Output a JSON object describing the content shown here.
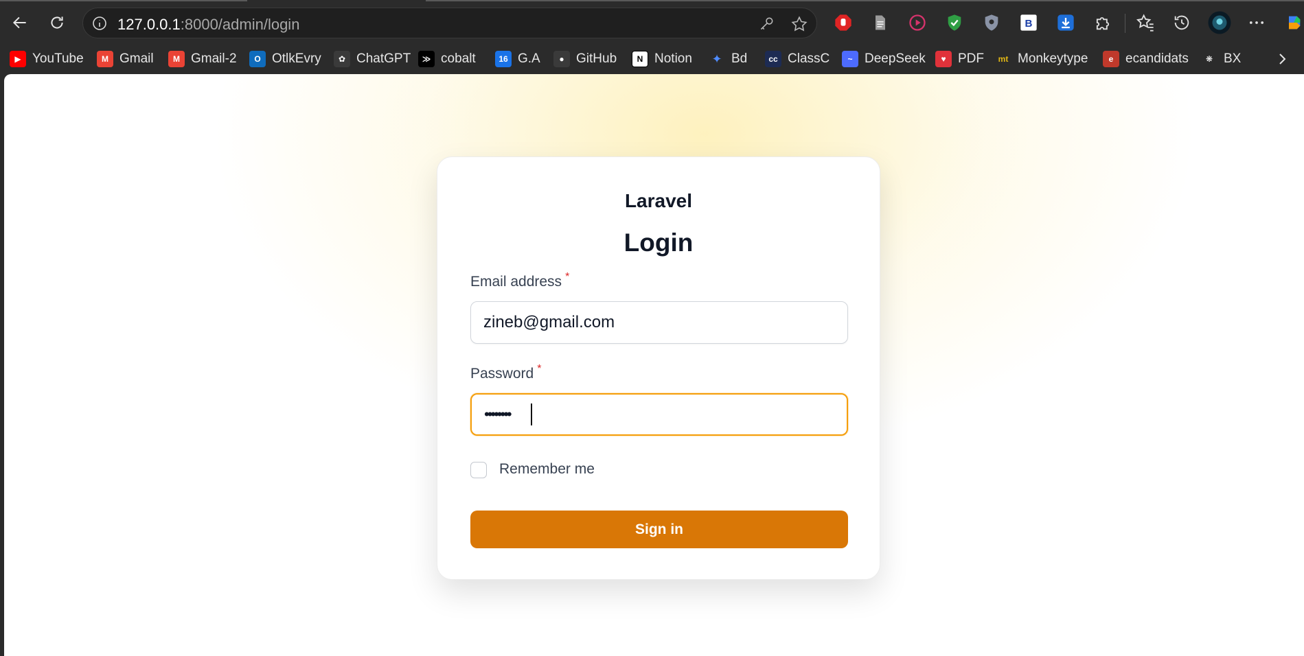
{
  "browser": {
    "address": {
      "host": "127.0.0.1",
      "path": ":8000/admin/login"
    },
    "bookmarks": [
      {
        "label": "YouTube",
        "icon": "youtube-icon",
        "color": "#ff0000",
        "glyph": "▶"
      },
      {
        "label": "Gmail",
        "icon": "gmail-icon",
        "color": "#ea4335",
        "glyph": "M"
      },
      {
        "label": "Gmail-2",
        "icon": "gmail-icon",
        "color": "#ea4335",
        "glyph": "M"
      },
      {
        "label": "OtlkEvry",
        "icon": "outlook-icon",
        "color": "#0f6cbd",
        "glyph": "O"
      },
      {
        "label": "ChatGPT",
        "icon": "chatgpt-icon",
        "color": "#3a3a3a",
        "glyph": "✿"
      },
      {
        "label": "cobalt",
        "icon": "cobalt-icon",
        "color": "#000000",
        "glyph": "≫"
      },
      {
        "label": "G.A",
        "icon": "calendar-icon",
        "color": "#1a73e8",
        "glyph": "16"
      },
      {
        "label": "GitHub",
        "icon": "github-icon",
        "color": "#3a3a3a",
        "glyph": "●"
      },
      {
        "label": "Notion",
        "icon": "notion-icon",
        "color": "#ffffff",
        "glyph": "N"
      },
      {
        "label": "Bd",
        "icon": "gemini-icon",
        "color": "#2b2b2b",
        "glyph": "✦"
      },
      {
        "label": "ClassC",
        "icon": "classc-icon",
        "color": "#1d2b53",
        "glyph": "cc"
      },
      {
        "label": "DeepSeek",
        "icon": "deepseek-icon",
        "color": "#4d6bfe",
        "glyph": "~"
      },
      {
        "label": "PDF",
        "icon": "pdf-heart-icon",
        "color": "#e0323a",
        "glyph": "♥"
      },
      {
        "label": "Monkeytype",
        "icon": "monkeytype-icon",
        "color": "#2b2b2b",
        "glyph": "mt"
      },
      {
        "label": "ecandidats",
        "icon": "ecandidats-icon",
        "color": "#c0392b",
        "glyph": "e"
      },
      {
        "label": "BX",
        "icon": "bx-icon",
        "color": "#2b2b2b",
        "glyph": "❋"
      }
    ]
  },
  "login": {
    "brand": "Laravel",
    "title": "Login",
    "email_label": "Email address",
    "email_value": "zineb@gmail.com",
    "password_label": "Password",
    "password_value": "••••••••",
    "required_mark": "*",
    "remember_label": "Remember me",
    "submit_label": "Sign in"
  },
  "colors": {
    "accent": "#d97706",
    "focus_ring": "#f59e0b",
    "required": "#dc2626"
  }
}
